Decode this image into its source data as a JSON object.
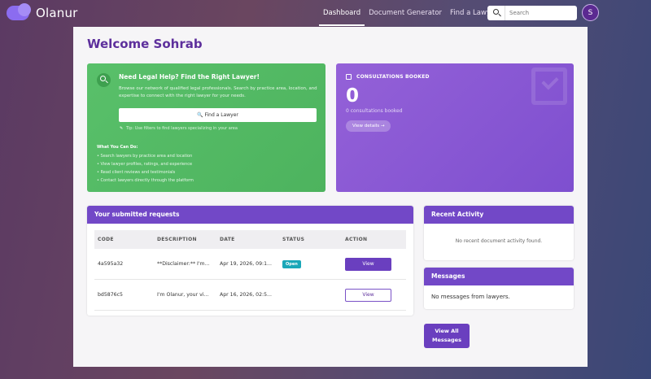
{
  "nav": {
    "brand": "Olanur",
    "links": [
      "Dashboard",
      "Document Generator",
      "Find a Lawyer"
    ],
    "search_placeholder": "Search",
    "avatar_initial": "S"
  },
  "welcome": "Welcome Sohrab",
  "legal_card": {
    "title": "Need Legal Help? Find the Right Lawyer!",
    "description": "Browse our network of qualified legal professionals. Search by practice area, location, and expertise to connect with the right lawyer for your needs.",
    "button": "🔍 Find a Lawyer",
    "tip": "Tip: Use filters to find lawyers specializing in your area",
    "list_title": "What You Can Do:",
    "list": [
      "Search lawyers by practice area and location",
      "View lawyer profiles, ratings, and experience",
      "Read client reviews and testimonials",
      "Contact lawyers directly through the platform"
    ]
  },
  "consult_card": {
    "label": "CONSULTATIONS BOOKED",
    "count": "0",
    "sub": "0 consultations booked",
    "button": "View details →"
  },
  "requests": {
    "title": "Your submitted requests",
    "columns": [
      "CODE",
      "DESCRIPTION",
      "DATE",
      "STATUS",
      "ACTION"
    ],
    "rows": [
      {
        "code": "4a595a32",
        "description": "**Disclaimer:** I'm...",
        "date": "Apr 19, 2026, 09:1...",
        "status": "Open",
        "action": "View"
      },
      {
        "code": "bd5876c5",
        "description": "I'm Olanur, your vi...",
        "date": "Apr 16, 2026, 02:5...",
        "status": "",
        "action": "View"
      }
    ]
  },
  "activity": {
    "title": "Recent Activity",
    "empty": "No recent document activity found."
  },
  "messages": {
    "title": "Messages",
    "empty": "No messages from lawyers.",
    "button_line1": "View All",
    "button_line2": "Messages"
  },
  "colors": {
    "accent_purple": "#7248c7",
    "green_card": "#55bb65",
    "status_open": "#1aa7b8"
  }
}
